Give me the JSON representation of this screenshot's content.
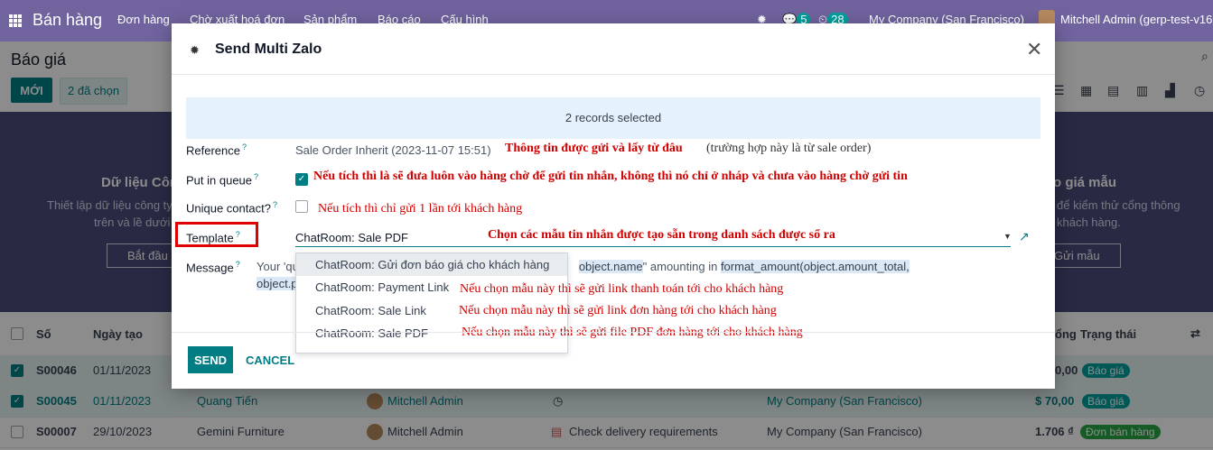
{
  "nav": {
    "app": "Bán hàng",
    "items": [
      "Đơn hàng",
      "Chờ xuất hoá đơn",
      "Sản phẩm",
      "Báo cáo",
      "Cấu hình"
    ],
    "chat_count": "5",
    "activity_count": "28",
    "company": "My Company (San Francisco)",
    "user": "Mitchell Admin (gerp-test-v16"
  },
  "control": {
    "breadcrumb": "Báo giá",
    "new_label": "MỚI",
    "selected_label": "2 đã chọn"
  },
  "banner": {
    "left_title": "Dữ liệu Côn",
    "left_line1": "Thiết lập dữ liệu công ty",
    "left_line2": "trên và lề dưới",
    "left_button": "Bắt đầu",
    "right_title": "o giá mẫu",
    "right_line1": "để kiểm thử cổng thông",
    "right_line2": "khách hàng.",
    "right_button": "Gửi mẫu"
  },
  "list": {
    "headers": {
      "number": "Số",
      "date": "Ngày tạo",
      "total": "ổng",
      "status": "Trạng thái"
    },
    "rows": [
      {
        "number": "S00046",
        "date": "01/11/2023",
        "customer": "",
        "salesperson": "",
        "activity": "",
        "company": "",
        "total": "0,00",
        "status": "Báo giá",
        "checked": true
      },
      {
        "number": "S00045",
        "date": "01/11/2023",
        "customer": "Quang Tiến",
        "salesperson": "Mitchell Admin",
        "activity": "",
        "company": "My Company (San Francisco)",
        "total": "$ 70,00",
        "status": "Báo giá",
        "checked": true
      },
      {
        "number": "S00007",
        "date": "29/10/2023",
        "customer": "Gemini Furniture",
        "salesperson": "Mitchell Admin",
        "activity": "Check delivery requirements",
        "company": "My Company (San Francisco)",
        "total": "1.706 ₫",
        "status": "Đơn bán hàng",
        "checked": false
      }
    ]
  },
  "modal": {
    "title": "Send Multi Zalo",
    "alert": "2 records selected",
    "reference_label": "Reference",
    "reference_value": "Sale Order Inherit  (2023-11-07 15:51)",
    "queue_label": "Put in queue",
    "unique_label": "Unique contact?",
    "template_label": "Template",
    "template_value": "ChatRoom: Sale PDF",
    "message_label": "Message",
    "message_prefix": "Your 'qu",
    "message_mid": "object.name",
    "message_after": "\" amounting in ",
    "message_fn": "format_amount(object.amount_total,",
    "message_line2": "object.p",
    "send_label": "SEND",
    "cancel_label": "CANCEL",
    "dropdown": [
      "ChatRoom: Gửi đơn báo giá cho khách hàng",
      "ChatRoom: Payment Link",
      "ChatRoom: Sale Link",
      "ChatRoom: Sale PDF"
    ],
    "notes": {
      "reference": "Thông tin được gửi và lấy từ đâu",
      "reference_tail": "(trường hợp này là từ sale order)",
      "queue": "Nếu tích thì là sẽ đưa luôn vào hàng chờ để gửi tin nhắn, không thì nó chỉ ở nháp và chưa vào hàng chờ gửi tin",
      "unique": "Nếu tích thì chỉ gửi 1 lần tới khách hàng",
      "template": "Chọn các mẫu tin nhắn được tạo sẵn trong danh sách được sổ ra",
      "payment": "Nếu chọn mẫu này thì sẽ gửi link thanh toán tới cho khách hàng",
      "sale_link": "Nếu chọn mẫu này thì sẽ gửi link đơn hàng tới cho khách hàng",
      "sale_pdf": "Nếu chọn mẫu này thì sẽ gửi file PDF đơn hàng tới cho khách hàng"
    }
  }
}
